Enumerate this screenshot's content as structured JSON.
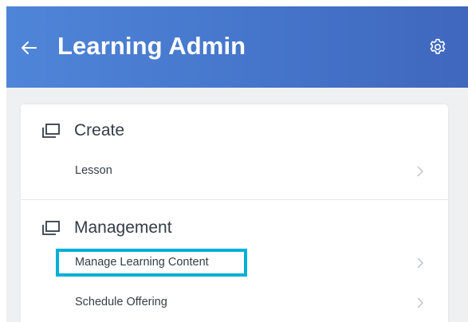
{
  "header": {
    "title": "Learning Admin",
    "back_icon": "arrow-left-icon",
    "settings_icon": "gear-icon",
    "background_colors": [
      "#4f85d8",
      "#3f67bd"
    ]
  },
  "sections": [
    {
      "title": "Create",
      "icon": "windows-stack-icon",
      "items": [
        {
          "label": "Lesson"
        }
      ]
    },
    {
      "title": "Management",
      "icon": "windows-stack-icon",
      "items": [
        {
          "label": "Manage Learning Content",
          "highlighted": true
        },
        {
          "label": "Schedule Offering"
        }
      ]
    }
  ],
  "highlight_color": "#00b0d8"
}
